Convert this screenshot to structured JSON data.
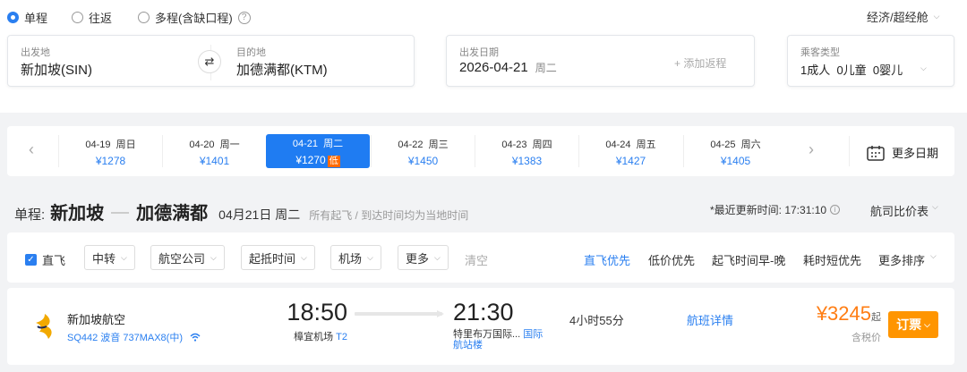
{
  "trip_types": {
    "one_way": "单程",
    "round_trip": "往返",
    "multi": "多程(含缺口程)"
  },
  "cabin_class": "经济/超经舱",
  "route": {
    "from_label": "出发地",
    "from_value": "新加坡(SIN)",
    "to_label": "目的地",
    "to_value": "加德满都(KTM)"
  },
  "date_box": {
    "label": "出发日期",
    "date": "2026-04-21",
    "weekday": "周二",
    "add_return": "+ 添加返程"
  },
  "passengers": {
    "label": "乘客类型",
    "value": "1成人  0儿童  0婴儿"
  },
  "date_strip": [
    {
      "date": "04-19  周日",
      "price": "¥1278"
    },
    {
      "date": "04-20  周一",
      "price": "¥1401"
    },
    {
      "date": "04-21  周二",
      "price": "¥1270",
      "tag": "低",
      "selected": true
    },
    {
      "date": "04-22  周三",
      "price": "¥1450"
    },
    {
      "date": "04-23  周四",
      "price": "¥1383"
    },
    {
      "date": "04-24  周五",
      "price": "¥1427"
    },
    {
      "date": "04-25  周六",
      "price": "¥1405"
    }
  ],
  "more_dates": "更多日期",
  "heading": {
    "prefix": "单程:",
    "from": "新加坡",
    "to": "加德满都",
    "date": "04月21日 周二",
    "note": "所有起飞 / 到达时间均为当地时间",
    "updated": "*最近更新时间: 17:31:10",
    "compare": "航司比价表"
  },
  "filters": {
    "direct": "直飞",
    "transfer": "中转",
    "airline": "航空公司",
    "time": "起抵时间",
    "airport": "机场",
    "more": "更多",
    "clear": "清空"
  },
  "sorts": {
    "direct_first": "直飞优先",
    "low_price": "低价优先",
    "early_late": "起飞时间早-晚",
    "shortest": "耗时短优先",
    "more": "更多排序"
  },
  "flight": {
    "airline": "新加坡航空",
    "info": "SQ442 波音 737MAX8(中)",
    "dep_time": "18:50",
    "dep_airport": "樟宜机场",
    "dep_terminal": "T2",
    "arr_time": "21:30",
    "arr_airport": "特里布万国际...",
    "arr_terminal_1": "国际",
    "arr_terminal_2": "航站楼",
    "duration": "4小时55分",
    "details": "航班详情",
    "price": "¥3245",
    "price_suffix": "起",
    "tax": "含税价",
    "book": "订票"
  },
  "colors": {
    "accent": "#2a7ff0",
    "price": "#ff7d13",
    "book_btn": "#ff9500"
  }
}
